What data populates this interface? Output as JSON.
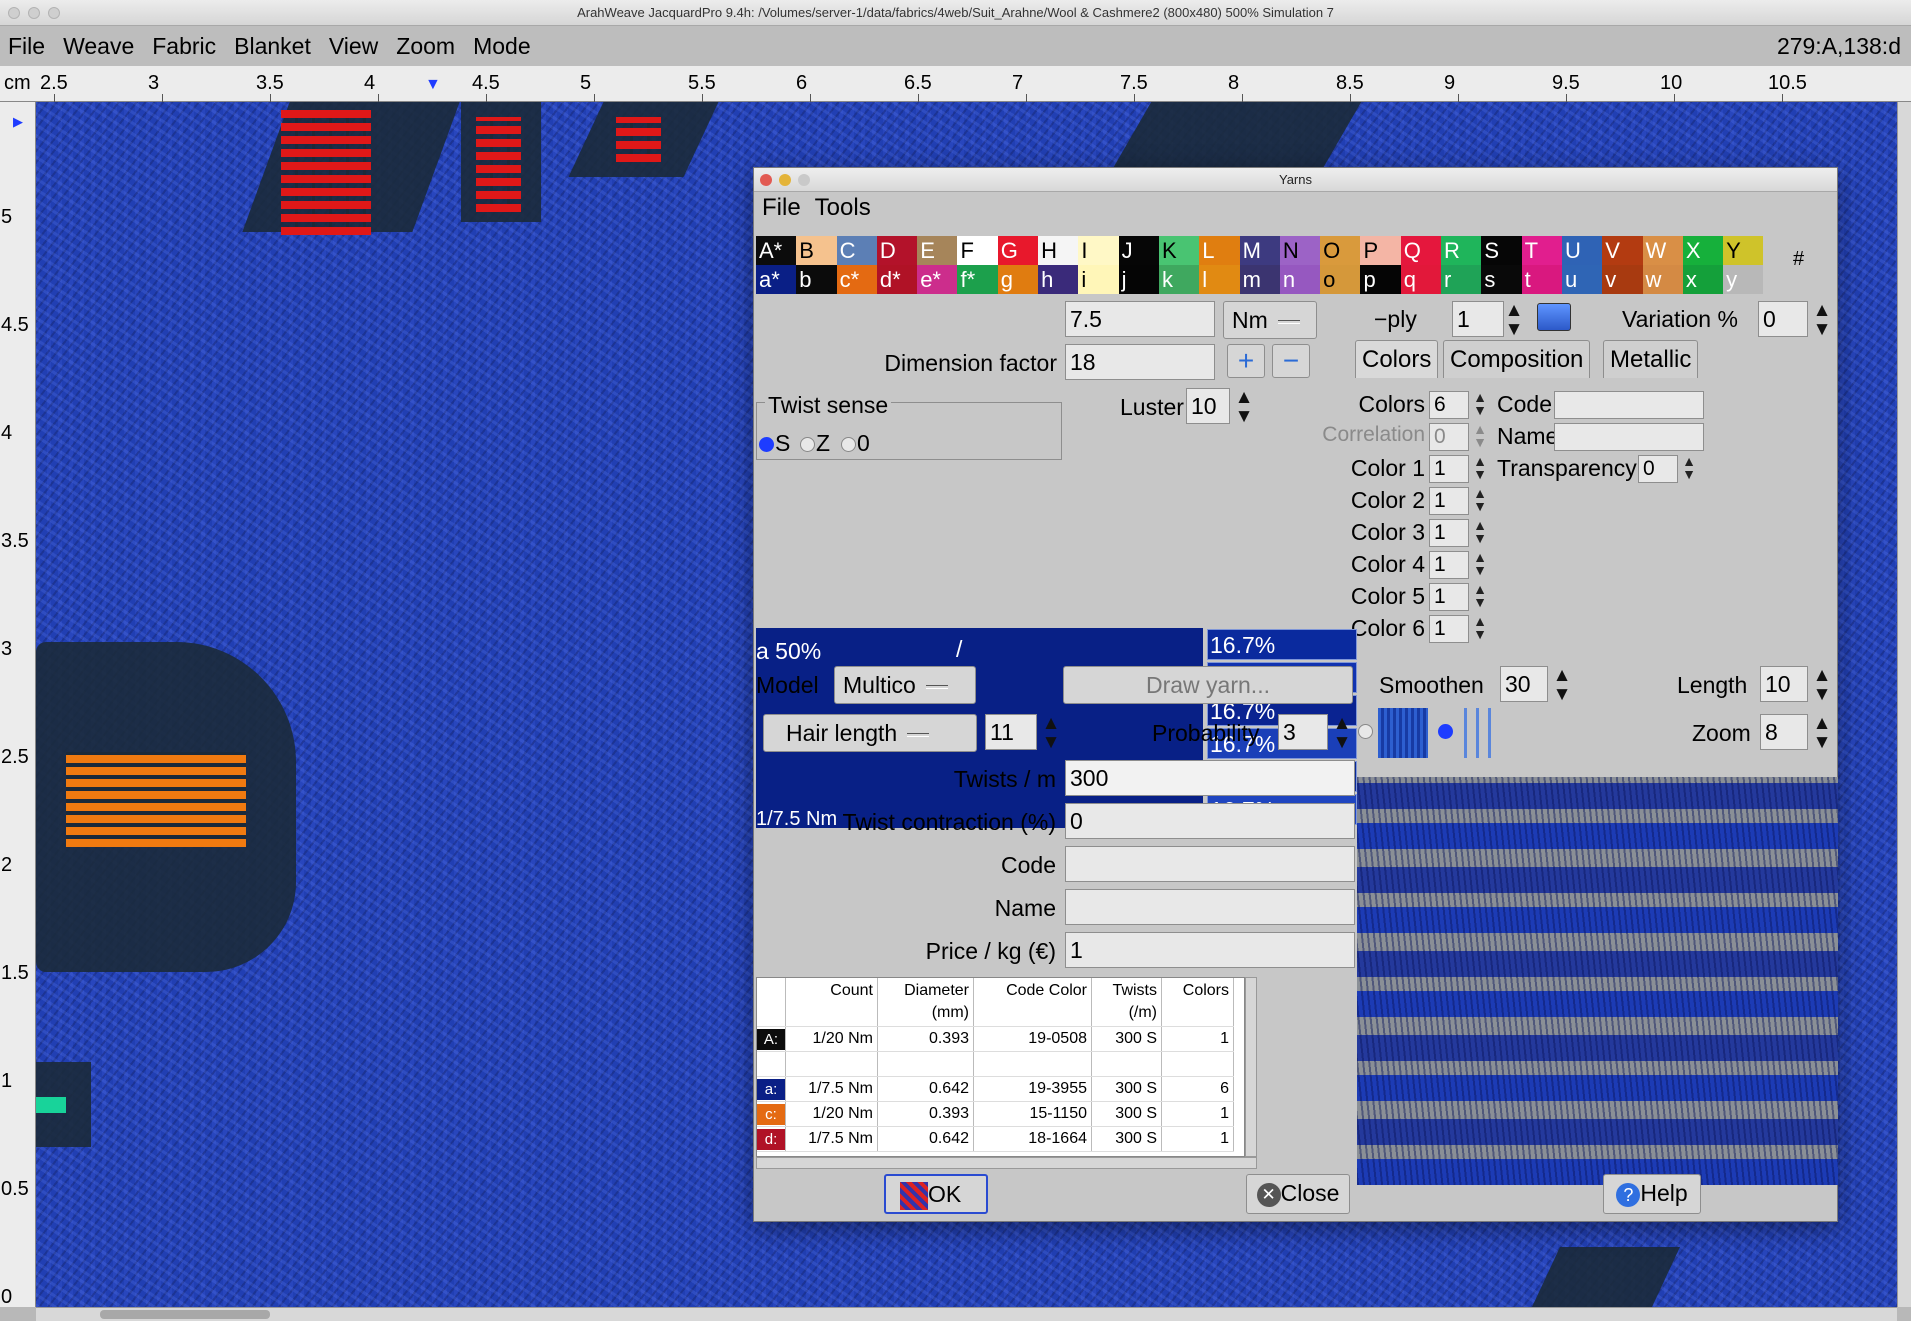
{
  "window": {
    "title": "ArahWeave JacquardPro 9.4h: /Volumes/server-1/data/fabrics/4web/Suit_Arahne/Wool & Cashmere2 (800x480) 500% Simulation 7"
  },
  "menubar": {
    "items": [
      "File",
      "Weave",
      "Fabric",
      "Blanket",
      "View",
      "Zoom",
      "Mode"
    ],
    "coords": "279:A,138:d"
  },
  "ruler": {
    "unit": "cm",
    "top_labels": [
      "2.5",
      "3",
      "3.5",
      "4",
      "4.5",
      "5",
      "5.5",
      "6",
      "6.5",
      "7",
      "7.5",
      "8",
      "8.5",
      "9",
      "9.5",
      "10",
      "10.5"
    ],
    "left_labels": [
      "5",
      "4.5",
      "4",
      "3.5",
      "3",
      "2.5",
      "2",
      "1.5",
      "1",
      "0.5",
      "0"
    ]
  },
  "dialog": {
    "title": "Yarns",
    "menu": [
      "File",
      "Tools"
    ],
    "palette_upper": [
      {
        "label": "A*",
        "bg": "#0c0c0c",
        "fg": "#ffffff"
      },
      {
        "label": "B",
        "bg": "#f5c28e",
        "fg": "#000000"
      },
      {
        "label": "C",
        "bg": "#5c7fb5",
        "fg": "#ffffff"
      },
      {
        "label": "D",
        "bg": "#b3122a",
        "fg": "#ffffff"
      },
      {
        "label": "E",
        "bg": "#a6855a",
        "fg": "#ffffff"
      },
      {
        "label": "F",
        "bg": "#ffffff",
        "fg": "#000000"
      },
      {
        "label": "G",
        "bg": "#e8182c",
        "fg": "#ffffff"
      },
      {
        "label": "H",
        "bg": "#f5f5f5",
        "fg": "#000000"
      },
      {
        "label": "I",
        "bg": "#fff8c6",
        "fg": "#000000"
      },
      {
        "label": "J",
        "bg": "#060606",
        "fg": "#ffffff"
      },
      {
        "label": "K",
        "bg": "#49c472",
        "fg": "#000000"
      },
      {
        "label": "L",
        "bg": "#e07e10",
        "fg": "#ffffff"
      },
      {
        "label": "M",
        "bg": "#3d3a80",
        "fg": "#ffffff"
      },
      {
        "label": "N",
        "bg": "#9c63c6",
        "fg": "#000000"
      },
      {
        "label": "O",
        "bg": "#d99a3c",
        "fg": "#000000"
      },
      {
        "label": "P",
        "bg": "#f4b5a5",
        "fg": "#000000"
      },
      {
        "label": "Q",
        "bg": "#e5173d",
        "fg": "#ffffff"
      },
      {
        "label": "R",
        "bg": "#1fb55b",
        "fg": "#ffffff"
      },
      {
        "label": "S",
        "bg": "#060606",
        "fg": "#ffffff"
      },
      {
        "label": "T",
        "bg": "#e11e8e",
        "fg": "#ffffff"
      },
      {
        "label": "U",
        "bg": "#2f63b5",
        "fg": "#ffffff"
      },
      {
        "label": "V",
        "bg": "#b33b11",
        "fg": "#ffffff"
      },
      {
        "label": "W",
        "bg": "#d98f46",
        "fg": "#ffffff"
      },
      {
        "label": "X",
        "bg": "#16b03b",
        "fg": "#ffffff"
      },
      {
        "label": "Y",
        "bg": "#cfc32a",
        "fg": "#000000"
      }
    ],
    "palette_lower": [
      {
        "label": "a*",
        "bg": "#0a1f86",
        "fg": "#ffffff"
      },
      {
        "label": "b",
        "bg": "#0b0b0b",
        "fg": "#ffffff"
      },
      {
        "label": "c*",
        "bg": "#e46a12",
        "fg": "#ffffff"
      },
      {
        "label": "d*",
        "bg": "#b01226",
        "fg": "#ffffff"
      },
      {
        "label": "e*",
        "bg": "#cc2d8c",
        "fg": "#ffffff"
      },
      {
        "label": "f*",
        "bg": "#1ca04c",
        "fg": "#ffffff"
      },
      {
        "label": "g",
        "bg": "#e07c10",
        "fg": "#ffffff"
      },
      {
        "label": "h",
        "bg": "#3a2a7a",
        "fg": "#ffffff"
      },
      {
        "label": "i",
        "bg": "#fff6b8",
        "fg": "#000000"
      },
      {
        "label": "j",
        "bg": "#050505",
        "fg": "#ffffff"
      },
      {
        "label": "k",
        "bg": "#3fa85f",
        "fg": "#ffffff"
      },
      {
        "label": "l",
        "bg": "#e18a12",
        "fg": "#ffffff"
      },
      {
        "label": "m",
        "bg": "#3b3470",
        "fg": "#ffffff"
      },
      {
        "label": "n",
        "bg": "#9658c0",
        "fg": "#ffffff"
      },
      {
        "label": "o",
        "bg": "#d5983a",
        "fg": "#000000"
      },
      {
        "label": "p",
        "bg": "#050505",
        "fg": "#ffffff"
      },
      {
        "label": "q",
        "bg": "#e2183a",
        "fg": "#ffffff"
      },
      {
        "label": "r",
        "bg": "#1fa357",
        "fg": "#ffffff"
      },
      {
        "label": "s",
        "bg": "#090909",
        "fg": "#ffffff"
      },
      {
        "label": "t",
        "bg": "#d9187f",
        "fg": "#ffffff"
      },
      {
        "label": "u",
        "bg": "#2f65b5",
        "fg": "#ffffff"
      },
      {
        "label": "v",
        "bg": "#a83a10",
        "fg": "#ffffff"
      },
      {
        "label": "w",
        "bg": "#d48a44",
        "fg": "#ffffff"
      },
      {
        "label": "x",
        "bg": "#14a03a",
        "fg": "#ffffff"
      },
      {
        "label": "y",
        "bg": "#b8b8b8",
        "fg": "#ffffff"
      }
    ],
    "palette_hash": "#",
    "count": {
      "label": "Count",
      "value": "7.5",
      "unit": "Nm"
    },
    "ply": {
      "label": "−ply",
      "value": "1"
    },
    "variation": {
      "label": "Variation %",
      "value": "0"
    },
    "dimension_factor": {
      "label": "Dimension factor",
      "value": "18"
    },
    "twist_sense": {
      "label": "Twist sense",
      "options": [
        "S",
        "Z",
        "0"
      ],
      "selected": "S"
    },
    "luster": {
      "label": "Luster",
      "value": "10"
    },
    "tabs": [
      "Colors",
      "Composition",
      "Metallic"
    ],
    "colors_panel": {
      "colors": {
        "label": "Colors",
        "value": "6"
      },
      "correlation": {
        "label": "Correlation",
        "value": "0"
      },
      "code": {
        "label": "Code",
        "value": ""
      },
      "name": {
        "label": "Name",
        "value": ""
      },
      "transparency": {
        "label": "Transparency",
        "value": "0"
      },
      "color_rows": [
        {
          "label": "Color 1",
          "value": "1"
        },
        {
          "label": "Color 2",
          "value": "1"
        },
        {
          "label": "Color 3",
          "value": "1"
        },
        {
          "label": "Color 4",
          "value": "1"
        },
        {
          "label": "Color 5",
          "value": "1"
        },
        {
          "label": "Color 6",
          "value": "1"
        }
      ]
    },
    "distribution": {
      "main_label": "a 50%",
      "slash": "/",
      "bottom_label": "1/7.5 Nm",
      "percents": [
        "16.7%",
        "16.7%",
        "16.7%",
        "16.7%",
        "16.7%",
        "16.7%"
      ]
    },
    "model": {
      "label": "Model",
      "value": "Multico"
    },
    "draw_yarn_button": "Draw yarn...",
    "smoothen": {
      "label": "Smoothen",
      "value": "30"
    },
    "length": {
      "label": "Length",
      "value": "10"
    },
    "hair_length": {
      "label": "Hair length",
      "value": "11"
    },
    "probability": {
      "label": "Probability",
      "value": "3"
    },
    "zoom": {
      "label": "Zoom",
      "value": "8"
    },
    "twists_per_m": {
      "label": "Twists / m",
      "value": "300"
    },
    "twist_contraction": {
      "label": "Twist contraction (%)",
      "value": "0"
    },
    "code_field": {
      "label": "Code",
      "value": ""
    },
    "name_field": {
      "label": "Name",
      "value": ""
    },
    "price": {
      "label": "Price / kg (€)",
      "value": "1"
    },
    "table": {
      "headers": [
        [
          "",
          ""
        ],
        [
          "Count",
          ""
        ],
        [
          "Diameter",
          "(mm)"
        ],
        [
          "Code Color",
          ""
        ],
        [
          "Twists",
          "(/m)"
        ],
        [
          "Colors",
          ""
        ]
      ],
      "rows": [
        {
          "yarn": "A:",
          "color": "#0c0c0c",
          "count": "1/20 Nm",
          "diameter": "0.393",
          "code_color": "19-0508",
          "twists": "300 S",
          "colors": "1"
        },
        {
          "yarn": "",
          "color": "",
          "count": "",
          "diameter": "",
          "code_color": "",
          "twists": "",
          "colors": ""
        },
        {
          "yarn": "a:",
          "color": "#0a1f86",
          "count": "1/7.5 Nm",
          "diameter": "0.642",
          "code_color": "19-3955",
          "twists": "300 S",
          "colors": "6"
        },
        {
          "yarn": "c:",
          "color": "#e46a12",
          "count": "1/20 Nm",
          "diameter": "0.393",
          "code_color": "15-1150",
          "twists": "300 S",
          "colors": "1"
        },
        {
          "yarn": "d:",
          "color": "#b01226",
          "count": "1/7.5 Nm",
          "diameter": "0.642",
          "code_color": "18-1664",
          "twists": "300 S",
          "colors": "1"
        }
      ]
    },
    "buttons": {
      "ok": "OK",
      "close": "Close",
      "help": "Help"
    }
  }
}
